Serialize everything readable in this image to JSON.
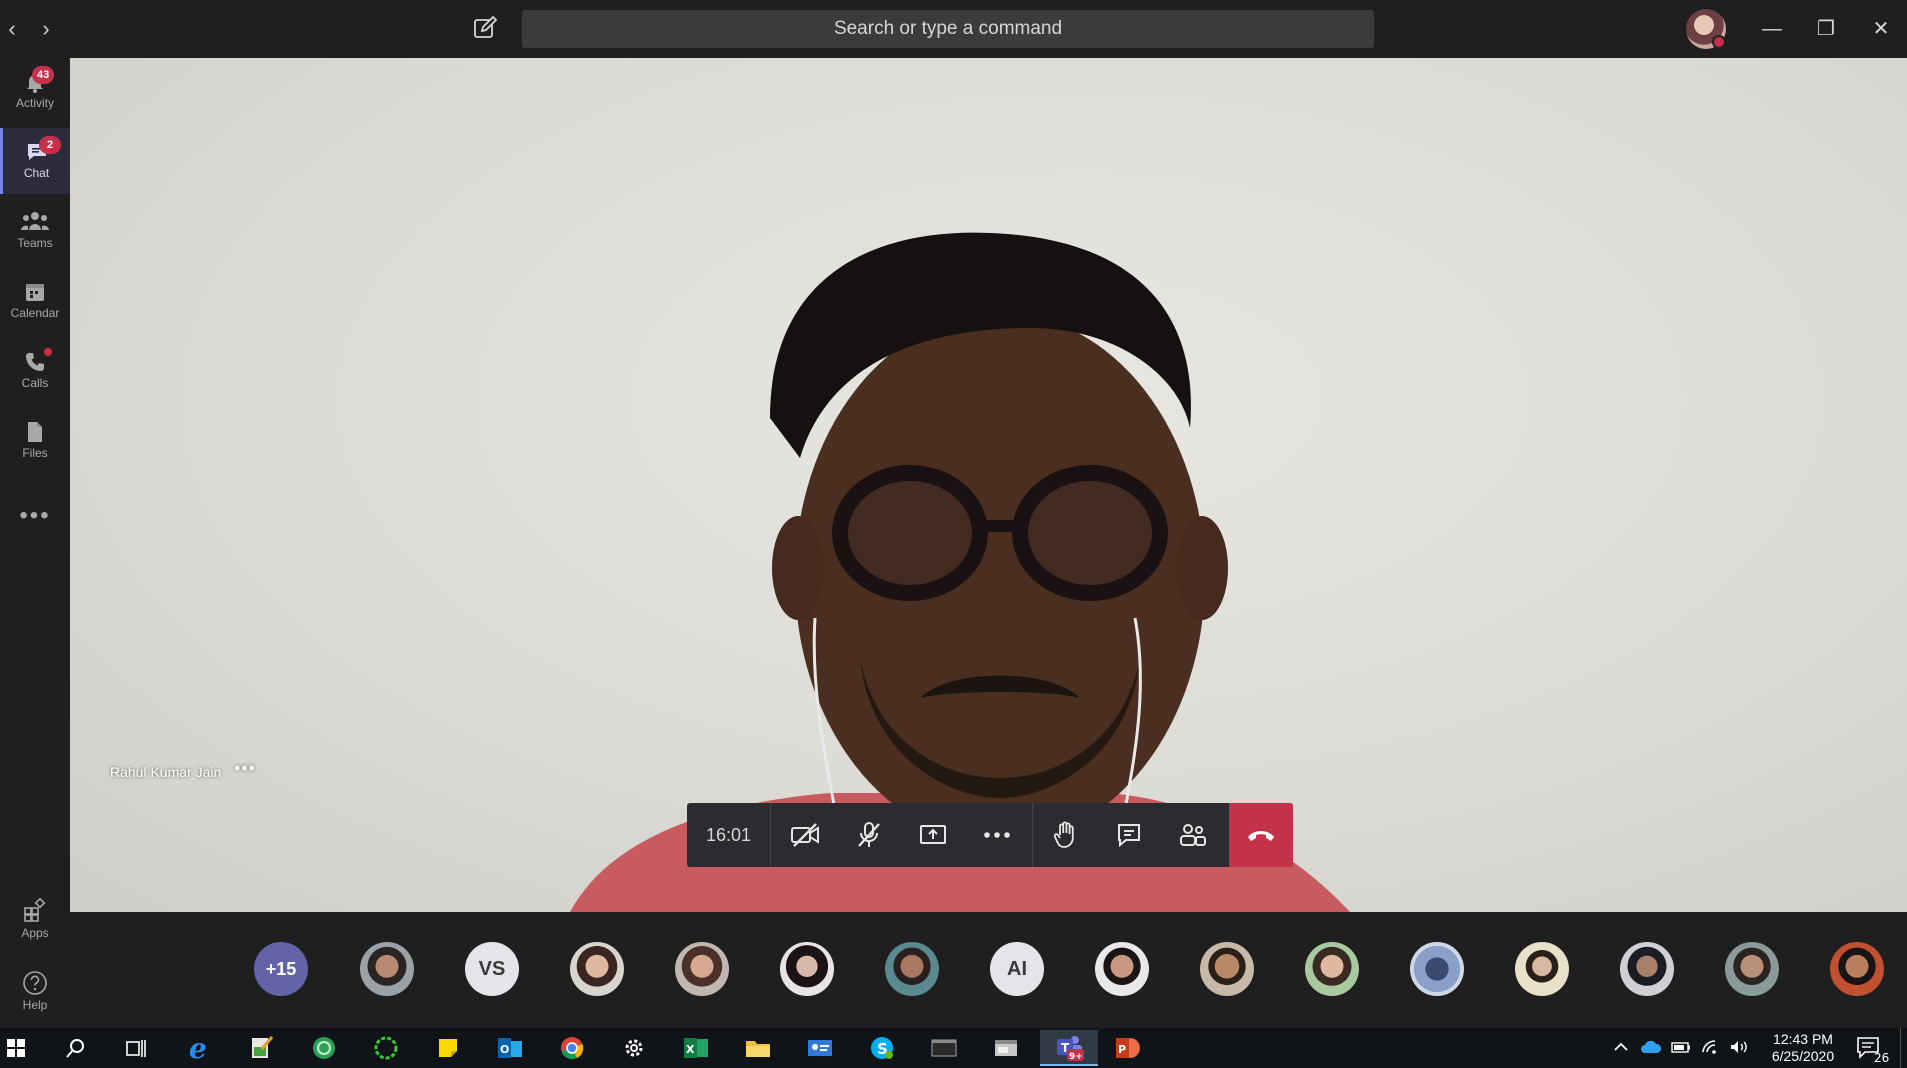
{
  "titlebar": {
    "back_label": "‹",
    "forward_label": "›",
    "search_placeholder": "Search or type a command",
    "minimize_label": "—",
    "restore_label": "❐",
    "close_label": "✕"
  },
  "rail": {
    "items": [
      {
        "label": "Activity",
        "badge": "43"
      },
      {
        "label": "Chat",
        "badge": "2"
      },
      {
        "label": "Teams",
        "badge": ""
      },
      {
        "label": "Calendar",
        "badge": ""
      },
      {
        "label": "Calls",
        "badge": ""
      },
      {
        "label": "Files",
        "badge": ""
      }
    ],
    "more_label": "•••",
    "apps_label": "Apps",
    "help_label": "Help"
  },
  "stage": {
    "participant_name": "Rahul Kumar Jain",
    "participant_more": "•••"
  },
  "controls": {
    "timer": "16:01",
    "icons": [
      "camera-off-icon",
      "mic-off-icon",
      "share-screen-icon",
      "more-actions-icon",
      "raise-hand-icon",
      "chat-icon",
      "participants-icon",
      "hang-up-icon"
    ]
  },
  "participants": {
    "overflow_label": "+15",
    "initials": [
      "VS",
      "AI"
    ]
  },
  "taskbar": {
    "time": "12:43 PM",
    "date": "6/25/2020",
    "notification_count": "26",
    "teams_badge": "9+"
  },
  "colors": {
    "accent": "#6264a7",
    "rail_active": "#7b83eb",
    "hangup": "#c4314b",
    "badge": "#c4314b",
    "background": "#1f1f1f"
  }
}
